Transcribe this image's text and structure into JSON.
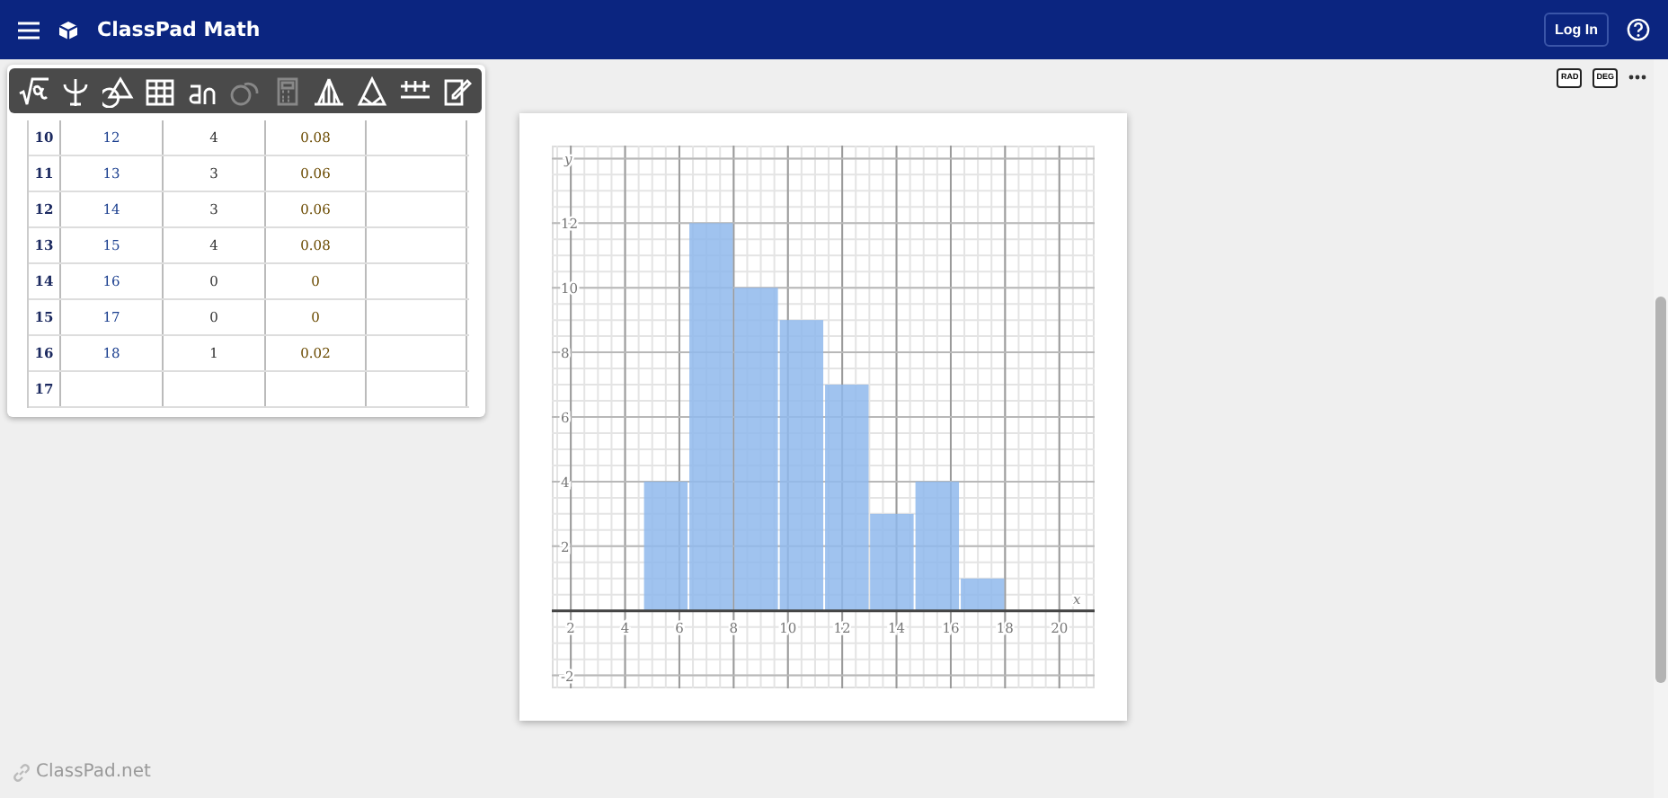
{
  "header": {
    "title": "ClassPad Math",
    "login": "Log In"
  },
  "side_buttons": [
    "RAD",
    "DEG"
  ],
  "table": {
    "rows": [
      {
        "index": "10",
        "cells": [
          "12",
          "4",
          "0.08",
          ""
        ]
      },
      {
        "index": "11",
        "cells": [
          "13",
          "3",
          "0.06",
          ""
        ]
      },
      {
        "index": "12",
        "cells": [
          "14",
          "3",
          "0.06",
          ""
        ]
      },
      {
        "index": "13",
        "cells": [
          "15",
          "4",
          "0.08",
          ""
        ]
      },
      {
        "index": "14",
        "cells": [
          "16",
          "0",
          "0",
          ""
        ]
      },
      {
        "index": "15",
        "cells": [
          "17",
          "0",
          "0",
          ""
        ]
      },
      {
        "index": "16",
        "cells": [
          "18",
          "1",
          "0.02",
          ""
        ]
      },
      {
        "index": "17",
        "cells": [
          "",
          "",
          "",
          ""
        ]
      }
    ]
  },
  "toolbar": [
    {
      "kind": "sqrt",
      "disabled": false
    },
    {
      "kind": "psi",
      "disabled": false
    },
    {
      "kind": "shapes",
      "disabled": false
    },
    {
      "kind": "grid",
      "disabled": false
    },
    {
      "kind": "an",
      "disabled": false
    },
    {
      "kind": "coins",
      "disabled": true
    },
    {
      "kind": "calc",
      "disabled": true
    },
    {
      "kind": "hist",
      "disabled": false
    },
    {
      "kind": "cone",
      "disabled": false
    },
    {
      "kind": "numline",
      "disabled": false
    },
    {
      "kind": "note",
      "disabled": false
    }
  ],
  "graph": {
    "chart_data": {
      "type": "bar",
      "xlabel": "x",
      "ylabel": "y",
      "x": [
        5.5,
        7.17,
        8.83,
        10.5,
        12.17,
        13.83,
        15.5,
        17.17
      ],
      "series": [
        {
          "color": "#8fb8ec",
          "values": [
            4,
            12,
            10,
            9,
            7,
            3,
            4,
            1
          ]
        }
      ],
      "grid": true,
      "xlim": [
        1.3,
        21.3
      ],
      "ylim": [
        -2.4,
        14.4
      ],
      "xticks": [
        2,
        4,
        6,
        8,
        10,
        12,
        14,
        16,
        18,
        20
      ],
      "yticks": [
        -2,
        2,
        4,
        6,
        8,
        10,
        12
      ]
    }
  },
  "footer": {
    "brand": "ClassPad.net"
  }
}
